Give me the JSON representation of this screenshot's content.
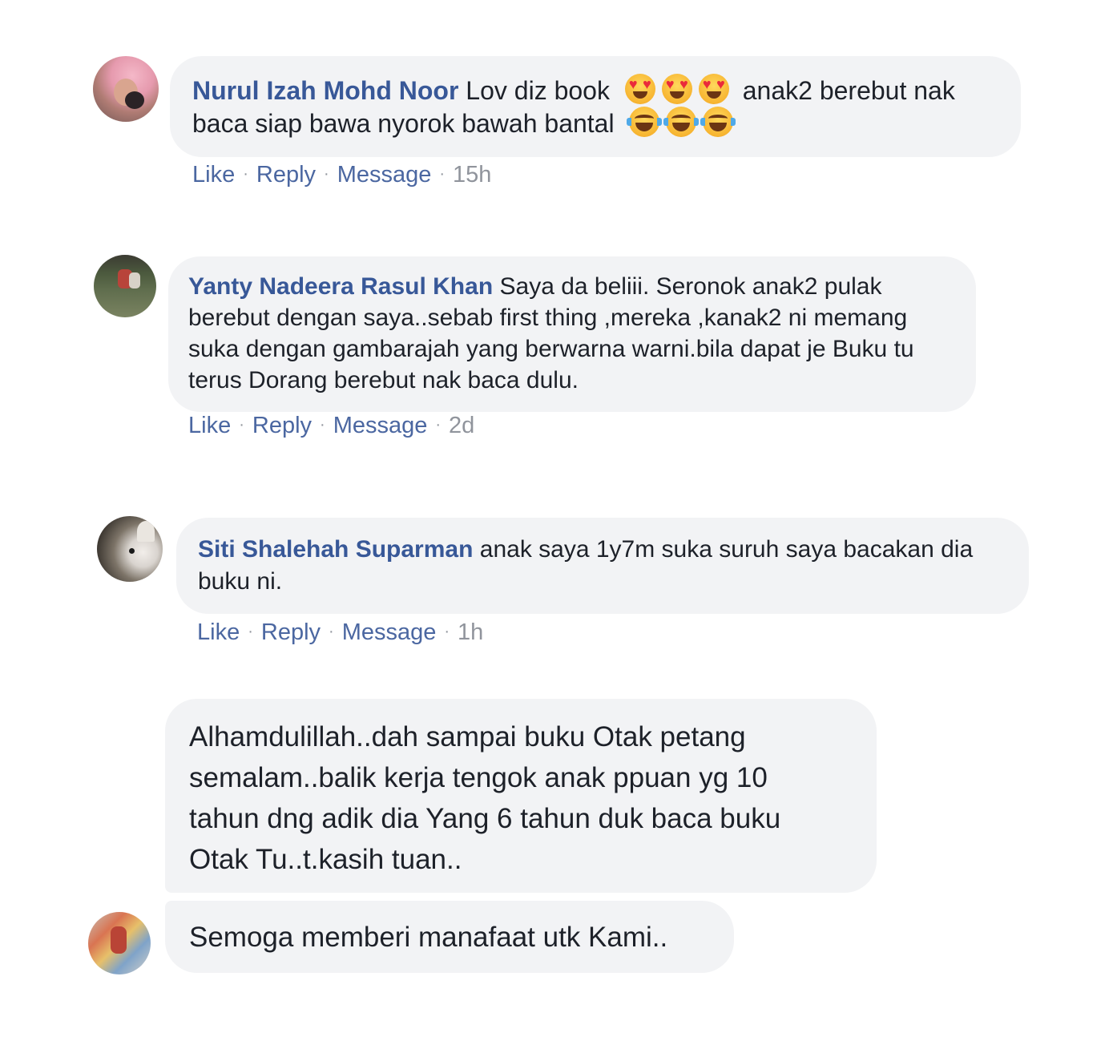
{
  "comments": [
    {
      "author": "Nurul Izah Mohd Noor",
      "text_part1": "Lov diz book",
      "emojis1": [
        "heart-eyes-emoji",
        "heart-eyes-emoji",
        "heart-eyes-emoji"
      ],
      "text_part2": "anak2 berebut nak baca siap bawa nyorok bawah bantal",
      "emojis2": [
        "tears-of-joy-emoji",
        "tears-of-joy-emoji",
        "tears-of-joy-emoji"
      ],
      "like": "Like",
      "reply": "Reply",
      "message": "Message",
      "time": "15h"
    },
    {
      "author": "Yanty Nadeera Rasul Khan",
      "text": "Saya da beliii. Seronok anak2 pulak berebut dengan saya..sebab first thing ,mereka ,kanak2 ni memang suka dengan gambarajah yang berwarna warni.bila dapat je Buku tu terus Dorang berebut nak baca dulu.",
      "like": "Like",
      "reply": "Reply",
      "message": "Message",
      "time": "2d"
    },
    {
      "author": "Siti Shalehah Suparman",
      "text": "anak saya 1y7m suka suruh saya bacakan dia buku ni.",
      "like": "Like",
      "reply": "Reply",
      "message": "Message",
      "time": "1h"
    },
    {
      "text": "Alhamdulillah..dah sampai buku Otak petang semalam..balik kerja tengok anak ppuan yg 10 tahun dng adik dia Yang 6 tahun duk baca buku Otak Tu..t.kasih tuan.."
    },
    {
      "text": "Semoga memberi manafaat utk Kami.."
    }
  ],
  "separator": "·"
}
